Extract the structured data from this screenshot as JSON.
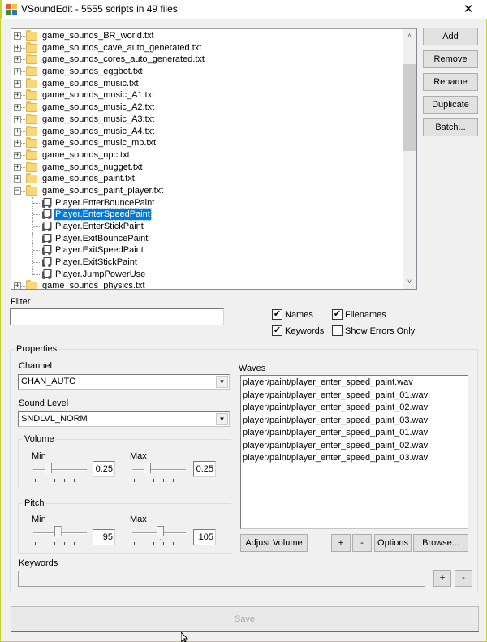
{
  "window": {
    "title": "VSoundEdit - 5555 scripts in 49 files",
    "close_glyph": "✕"
  },
  "tree": {
    "files": [
      {
        "name": "game_sounds_BR_world.txt",
        "expanded": false
      },
      {
        "name": "game_sounds_cave_auto_generated.txt",
        "expanded": false
      },
      {
        "name": "game_sounds_cores_auto_generated.txt",
        "expanded": false
      },
      {
        "name": "game_sounds_eggbot.txt",
        "expanded": false
      },
      {
        "name": "game_sounds_music.txt",
        "expanded": false
      },
      {
        "name": "game_sounds_music_A1.txt",
        "expanded": false
      },
      {
        "name": "game_sounds_music_A2.txt",
        "expanded": false
      },
      {
        "name": "game_sounds_music_A3.txt",
        "expanded": false
      },
      {
        "name": "game_sounds_music_A4.txt",
        "expanded": false
      },
      {
        "name": "game_sounds_music_mp.txt",
        "expanded": false
      },
      {
        "name": "game_sounds_npc.txt",
        "expanded": false
      },
      {
        "name": "game_sounds_nugget.txt",
        "expanded": false
      },
      {
        "name": "game_sounds_paint.txt",
        "expanded": false
      },
      {
        "name": "game_sounds_paint_player.txt",
        "expanded": true
      },
      {
        "name": "game_sounds_physics.txt",
        "expanded": false
      }
    ],
    "children": [
      {
        "name": "Player.EnterBouncePaint",
        "selected": false
      },
      {
        "name": "Player.EnterSpeedPaint",
        "selected": true
      },
      {
        "name": "Player.EnterStickPaint",
        "selected": false
      },
      {
        "name": "Player.ExitBouncePaint",
        "selected": false
      },
      {
        "name": "Player.ExitSpeedPaint",
        "selected": false
      },
      {
        "name": "Player.ExitStickPaint",
        "selected": false
      },
      {
        "name": "Player.JumpPowerUse",
        "selected": false
      }
    ],
    "expand_glyph": "+",
    "collapse_glyph": "−",
    "scroll_up_glyph": "˄",
    "scroll_down_glyph": "˅"
  },
  "side_buttons": {
    "add": "Add",
    "remove": "Remove",
    "rename": "Rename",
    "duplicate": "Duplicate",
    "batch": "Batch..."
  },
  "filter": {
    "label": "Filter",
    "value": "",
    "placeholder": "",
    "names": {
      "label": "Names",
      "checked": true
    },
    "filenames": {
      "label": "Filenames",
      "checked": true
    },
    "keywords": {
      "label": "Keywords",
      "checked": true
    },
    "show_errors_only": {
      "label": "Show Errors Only",
      "checked": false
    },
    "check_glyph": "✔"
  },
  "properties": {
    "title": "Properties",
    "channel": {
      "label": "Channel",
      "value": "CHAN_AUTO"
    },
    "sound_level": {
      "label": "Sound Level",
      "value": "SNDLVL_NORM"
    },
    "dropdown_glyph": "▼",
    "volume": {
      "title": "Volume",
      "min": {
        "label": "Min",
        "value": "0.25",
        "slider_fraction": 0.25
      },
      "max": {
        "label": "Max",
        "value": "0.25",
        "slider_fraction": 0.25
      }
    },
    "pitch": {
      "title": "Pitch",
      "min": {
        "label": "Min",
        "value": "95",
        "slider_fraction": 0.45
      },
      "max": {
        "label": "Max",
        "value": "105",
        "slider_fraction": 0.53
      }
    },
    "waves": {
      "label": "Waves",
      "items": [
        "player/paint/player_enter_speed_paint.wav",
        "player/paint/player_enter_speed_paint_01.wav",
        "player/paint/player_enter_speed_paint_02.wav",
        "player/paint/player_enter_speed_paint_03.wav",
        "player/paint/player_enter_speed_paint_01.wav",
        "player/paint/player_enter_speed_paint_02.wav",
        "player/paint/player_enter_speed_paint_03.wav"
      ],
      "adjust_volume": "Adjust Volume",
      "add": "+",
      "remove": "-",
      "options": "Options",
      "browse": "Browse..."
    },
    "keywords": {
      "label": "Keywords",
      "value": "",
      "add": "+",
      "remove": "-"
    }
  },
  "save_button": "Save"
}
